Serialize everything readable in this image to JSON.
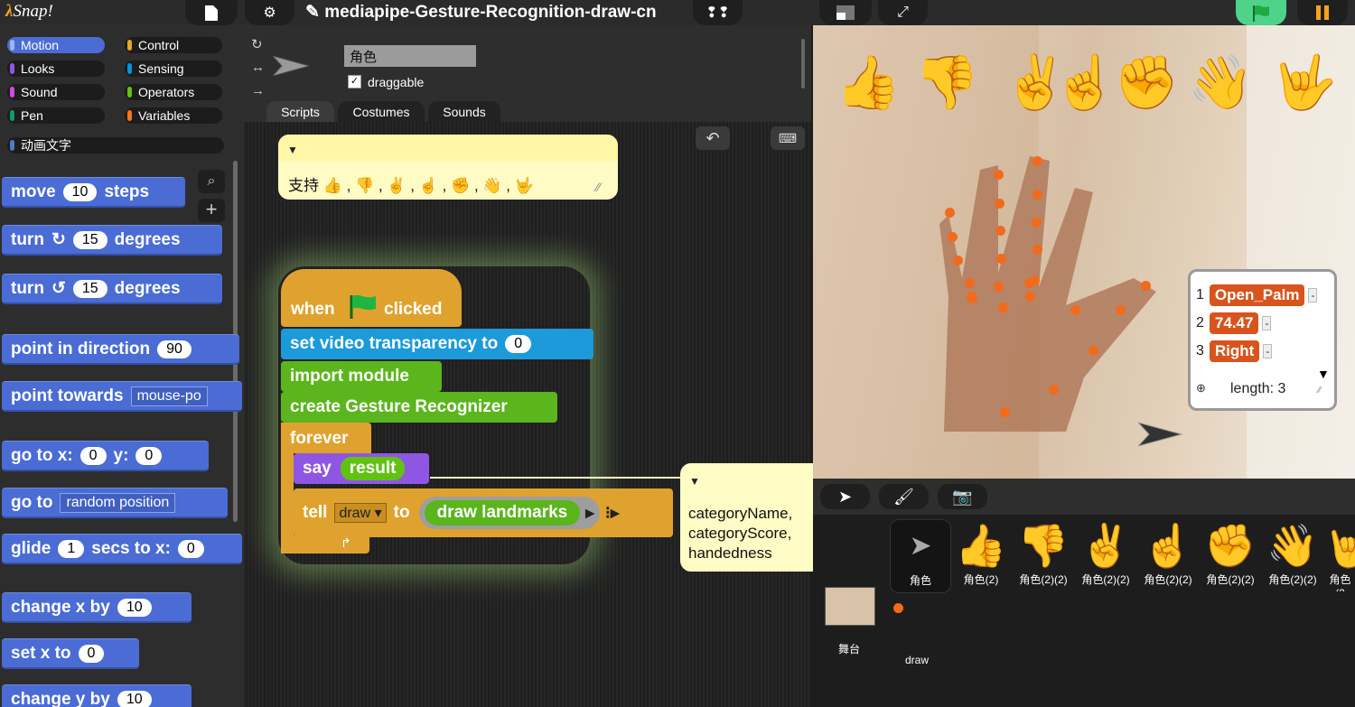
{
  "app": {
    "logo": "Snap!",
    "project_title": "mediapipe-Gesture-Recognition-draw-cn"
  },
  "palette": {
    "categories": [
      {
        "label": "Motion",
        "color": "#4a6cd4"
      },
      {
        "label": "Looks",
        "color": "#8f56e3"
      },
      {
        "label": "Sound",
        "color": "#cf4ad9"
      },
      {
        "label": "Pen",
        "color": "#0e9a6c"
      },
      {
        "label": "Control",
        "color": "#e6a822"
      },
      {
        "label": "Sensing",
        "color": "#0494dc"
      },
      {
        "label": "Operators",
        "color": "#62c213"
      },
      {
        "label": "Variables",
        "color": "#f3761d"
      }
    ],
    "extra_category": "动画文字",
    "blocks": {
      "move": {
        "w1": "move",
        "v": "10",
        "w2": "steps"
      },
      "turn_cw": {
        "w1": "turn",
        "v": "15",
        "w2": "degrees"
      },
      "turn_ccw": {
        "w1": "turn",
        "v": "15",
        "w2": "degrees"
      },
      "point_dir": {
        "w1": "point in direction",
        "v": "90"
      },
      "point_towards": {
        "w1": "point towards",
        "v": "mouse-po"
      },
      "goto_xy": {
        "w1": "go to x:",
        "x": "0",
        "w2": "y:",
        "y": "0"
      },
      "goto": {
        "w1": "go to",
        "v": "random position"
      },
      "glide": {
        "w1": "glide",
        "v": "1",
        "w2": "secs to x:",
        "x": "0"
      },
      "change_x": {
        "w1": "change x by",
        "v": "10"
      },
      "set_x": {
        "w1": "set x to",
        "v": "0"
      },
      "change_y": {
        "w1": "change y by",
        "v": "10"
      }
    }
  },
  "sprite_bar": {
    "name": "角色",
    "draggable_label": "draggable",
    "draggable_checked": "✓",
    "tabs": [
      "Scripts",
      "Costumes",
      "Sounds"
    ]
  },
  "scripts": {
    "note1": "支持 👍 , 👎 , ✌ , ☝ , ✊ , 👋 , 🤟",
    "hat": {
      "w1": "when",
      "w2": "clicked"
    },
    "set_video": {
      "w1": "set video transparency to",
      "v": "0"
    },
    "import_module": "import module",
    "create_recognizer": "create Gesture Recognizer",
    "forever": "forever",
    "say": {
      "w1": "say",
      "v": "result"
    },
    "tell": {
      "w1": "tell",
      "target": "draw",
      "w2": "to",
      "ring": "draw landmarks"
    },
    "note2": {
      "line1": "categoryName,",
      "line2": "categoryScore,",
      "line3": "handedness"
    }
  },
  "stage": {
    "emojis": [
      "👍",
      "👎",
      "✌",
      "☝",
      "✊",
      "👋",
      "🤟"
    ],
    "list": {
      "items": [
        {
          "index": "1",
          "value": "Open_Palm"
        },
        {
          "index": "2",
          "value": "74.47"
        },
        {
          "index": "3",
          "value": "Right"
        }
      ],
      "length_label": "length: 3"
    }
  },
  "corral": {
    "sprites": [
      {
        "label": "角色",
        "icon": "➤"
      },
      {
        "label": "角色(2)",
        "icon": "👍"
      },
      {
        "label": "角色(2)(2)",
        "icon": "👎"
      },
      {
        "label": "角色(2)(2)",
        "icon": "✌"
      },
      {
        "label": "角色(2)(2)",
        "icon": "☝"
      },
      {
        "label": "角色(2)(2)",
        "icon": "✊"
      },
      {
        "label": "角色(2)(2)",
        "icon": "👋"
      },
      {
        "label": "角色(2",
        "icon": "🤟"
      }
    ],
    "stage_label": "舞台",
    "draw_label": "draw"
  },
  "colors": {
    "motion": "#4a6cd4",
    "control": "#e0a22e",
    "looks": "#8f56e3",
    "sensing": "#0494dc",
    "operators": "#62c213",
    "landmark": "#f26a1b"
  }
}
